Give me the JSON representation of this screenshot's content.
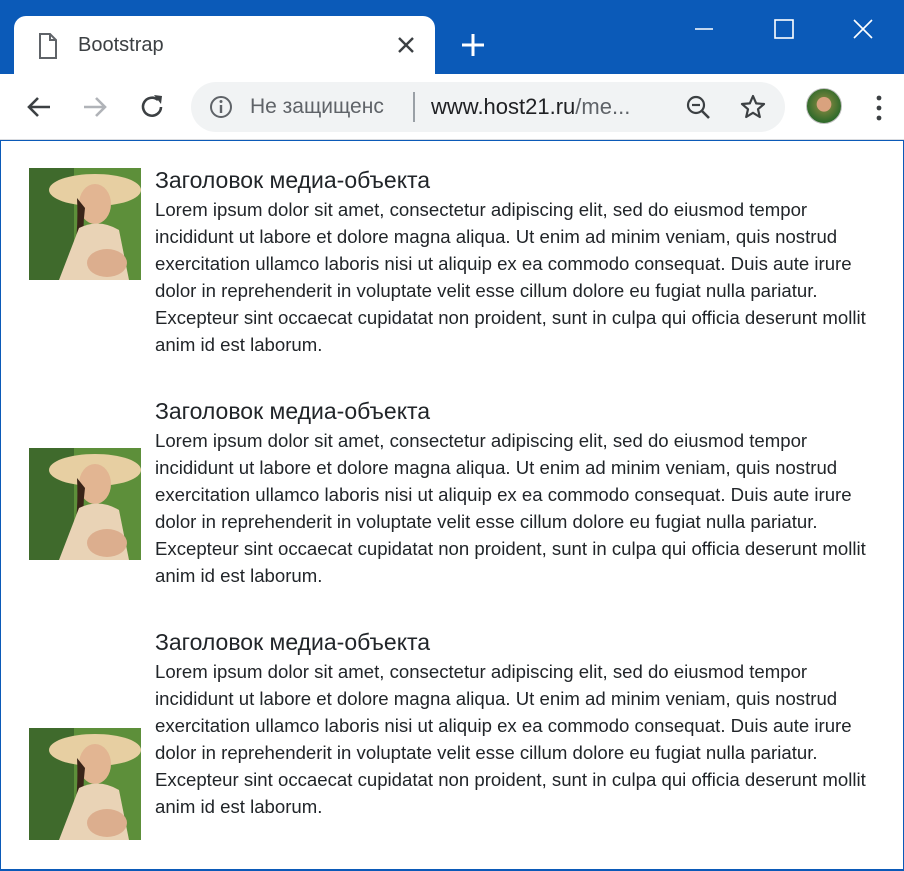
{
  "browser": {
    "tab": {
      "title": "Bootstrap",
      "icon": "page-icon"
    },
    "toolbar": {
      "security_text": "Не защищенс",
      "url_host": "www.host21.ru",
      "url_path": "/me..."
    }
  },
  "media_items": [
    {
      "heading": "Заголовок медиа-объекта",
      "body": "Lorem ipsum dolor sit amet, consectetur adipiscing elit, sed do eiusmod tempor incididunt ut labore et dolore magna aliqua. Ut enim ad minim veniam, quis nostrud exercitation ullamco laboris nisi ut aliquip ex ea commodo consequat. Duis aute irure dolor in reprehenderit in voluptate velit esse cillum dolore eu fugiat nulla pariatur. Excepteur sint occaecat cupidatat non proident, sunt in culpa qui officia deserunt mollit anim id est laborum.",
      "image_alignment": "top"
    },
    {
      "heading": "Заголовок медиа-объекта",
      "body": "Lorem ipsum dolor sit amet, consectetur adipiscing elit, sed do eiusmod tempor incididunt ut labore et dolore magna aliqua. Ut enim ad minim veniam, quis nostrud exercitation ullamco laboris nisi ut aliquip ex ea commodo consequat. Duis aute irure dolor in reprehenderit in voluptate velit esse cillum dolore eu fugiat nulla pariatur. Excepteur sint occaecat cupidatat non proident, sunt in culpa qui officia deserunt mollit anim id est laborum.",
      "image_alignment": "middle"
    },
    {
      "heading": "Заголовок медиа-объекта",
      "body": "Lorem ipsum dolor sit amet, consectetur adipiscing elit, sed do eiusmod tempor incididunt ut labore et dolore magna aliqua. Ut enim ad minim veniam, quis nostrud exercitation ullamco laboris nisi ut aliquip ex ea commodo consequat. Duis aute irure dolor in reprehenderit in voluptate velit esse cillum dolore eu fugiat nulla pariatur. Excepteur sint occaecat cupidatat non proident, sunt in culpa qui officia deserunt mollit anim id est laborum.",
      "image_alignment": "bottom"
    }
  ],
  "colors": {
    "chrome_frame": "#0b5ab8",
    "text": "#212529"
  }
}
